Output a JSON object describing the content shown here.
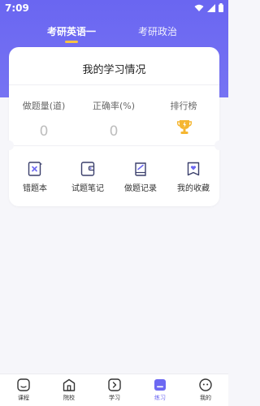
{
  "status_bar": {
    "time": "7:09",
    "icons": [
      "wifi-icon",
      "signal-icon",
      "battery-icon"
    ]
  },
  "tabs": [
    {
      "label": "考研英语一",
      "active": true
    },
    {
      "label": "考研政治",
      "active": false
    }
  ],
  "card": {
    "title": "我的学习情况",
    "stats": [
      {
        "label": "做题量(道)",
        "value": "0"
      },
      {
        "label": "正确率(%)",
        "value": "0"
      },
      {
        "label": "排行榜",
        "icon": "trophy-icon"
      }
    ],
    "actions": [
      {
        "label": "错题本",
        "icon": "wrong-book-icon"
      },
      {
        "label": "试题笔记",
        "icon": "note-icon"
      },
      {
        "label": "做题记录",
        "icon": "record-icon"
      },
      {
        "label": "我的收藏",
        "icon": "favorite-icon"
      }
    ]
  },
  "bottom_nav": [
    {
      "label": "课程",
      "icon": "course-icon",
      "active": false
    },
    {
      "label": "院校",
      "icon": "school-icon",
      "active": false
    },
    {
      "label": "学习",
      "icon": "study-icon",
      "active": false
    },
    {
      "label": "练习",
      "icon": "practice-icon",
      "active": true
    },
    {
      "label": "我的",
      "icon": "profile-icon",
      "active": false
    }
  ],
  "colors": {
    "primary": "#6c68f2",
    "accent": "#f6c343",
    "background": "#f6f6fa"
  }
}
